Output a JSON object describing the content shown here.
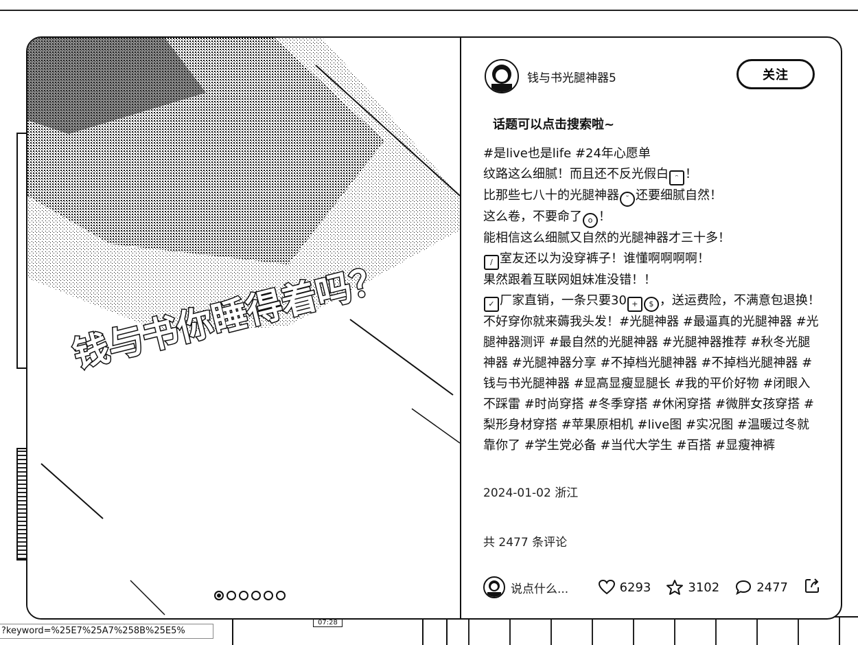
{
  "browser": {
    "status_url": "?keyword=%25E7%25A7%258B%25E5%"
  },
  "background": {
    "video_time": "07:28"
  },
  "media": {
    "overlay_text": "钱与书你睡得着吗？",
    "slide_count": 6,
    "active_slide": 1
  },
  "post": {
    "author": "钱与书光腿神器5",
    "follow_label": "关注",
    "tip": "话题可以点击搜索啦~",
    "lines": [
      "#是live也是life #24年心愿单",
      "纹路这么细腻！而且还不反光假白",
      "比那些七八十的光腿神器",
      "还要细腻自然！",
      "这么卷，不要命了",
      "能相信这么细腻又自然的光腿神器才三十多！",
      "室友还以为没穿裤子！谁懂啊啊啊啊！",
      "果然跟着互联网姐妹准没错！！",
      "厂家直销，一条只要30",
      "，送运费险，不满意包退换！不好穿你就来薅我头发！#光腿神器 #最逼真的光腿神器 #光腿神器测评 #最自然的光腿神器 #光腿神器推荐 #秋冬光腿神器 #光腿神器分享 #不掉档光腿神器 #不掉档光腿神器 #钱与书光腿神器 #显高显瘦显腿长 #我的平价好物 #闭眼入不踩雷 #时尚穿搭 #冬季穿搭 #休闲穿搭 #微胖女孩穿搭 #梨形身材穿搭 #苹果原相机 #live图 #实况图 #温暖过冬就靠你了 #学生党必备 #当代大学生 #百搭 #显瘦神裤"
    ],
    "date_location": "2024-01-02 浙江",
    "comment_total": "共 2477 条评论"
  },
  "actions": {
    "comment_placeholder": "说点什么...",
    "likes": "6293",
    "favorites": "3102",
    "comments": "2477"
  },
  "icons": {
    "like": "heart-icon",
    "favorite": "star-icon",
    "comment": "chat-bubble-icon",
    "share": "share-icon"
  }
}
